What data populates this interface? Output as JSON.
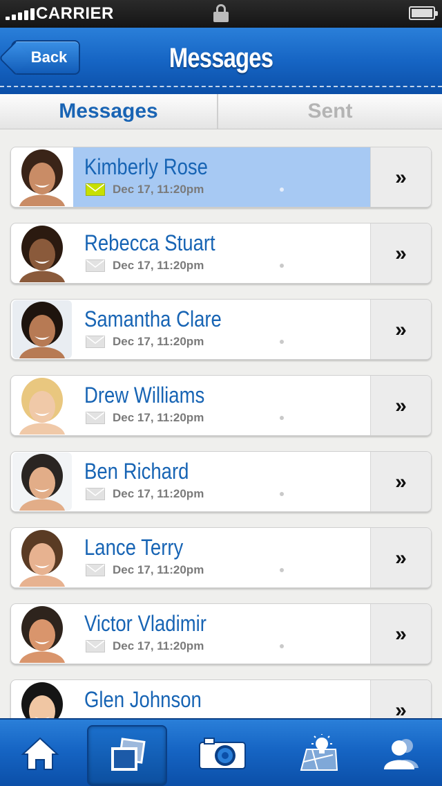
{
  "status_bar": {
    "carrier": "CARRIER",
    "signal_icon": "signal-bars-icon",
    "lock_icon": "lock-icon",
    "battery_icon": "battery-icon"
  },
  "nav": {
    "back_label": "Back",
    "title": "Messages"
  },
  "tabs": [
    {
      "label": "Messages",
      "active": true
    },
    {
      "label": "Sent",
      "active": false
    }
  ],
  "colors": {
    "accent": "#1665c4",
    "name_text": "#1764b4",
    "selected_row": "#a7c9f3",
    "unread_mail": "#c8e000"
  },
  "messages": [
    {
      "name": "Kimberly Rose",
      "date": "Dec 17, 11:20pm",
      "unread": true,
      "selected": true
    },
    {
      "name": "Rebecca Stuart",
      "date": "Dec 17, 11:20pm",
      "unread": false,
      "selected": false
    },
    {
      "name": "Samantha Clare",
      "date": "Dec 17, 11:20pm",
      "unread": false,
      "selected": false
    },
    {
      "name": "Drew Williams",
      "date": "Dec 17, 11:20pm",
      "unread": false,
      "selected": false
    },
    {
      "name": "Ben Richard",
      "date": "Dec 17, 11:20pm",
      "unread": false,
      "selected": false
    },
    {
      "name": "Lance Terry",
      "date": "Dec 17, 11:20pm",
      "unread": false,
      "selected": false
    },
    {
      "name": "Victor Vladimir",
      "date": "Dec 17, 11:20pm",
      "unread": false,
      "selected": false
    },
    {
      "name": "Glen Johnson",
      "date": "",
      "unread": false,
      "selected": false
    }
  ],
  "row_action": "»",
  "tab_bar": [
    {
      "icon": "home-icon",
      "active": false
    },
    {
      "icon": "gallery-icon",
      "active": true
    },
    {
      "icon": "camera-icon",
      "active": false
    },
    {
      "icon": "map-idea-icon",
      "active": false
    },
    {
      "icon": "contacts-icon",
      "active": false
    }
  ]
}
